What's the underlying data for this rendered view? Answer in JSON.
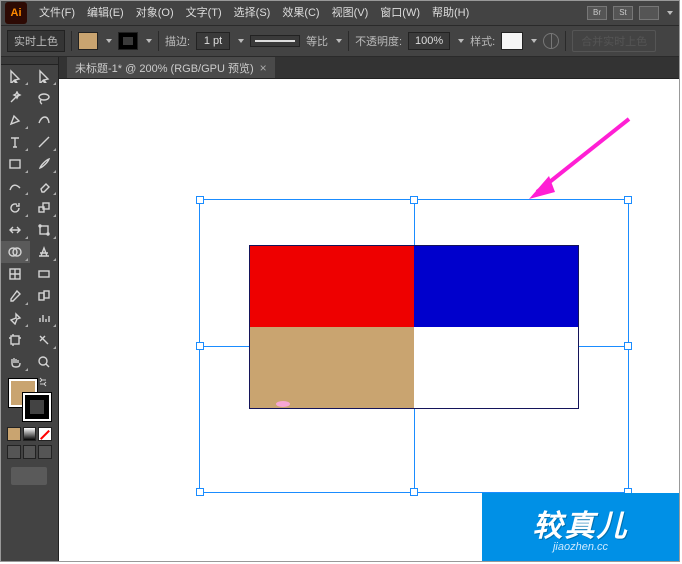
{
  "app_logo": "Ai",
  "menu": {
    "file": "文件(F)",
    "edit": "编辑(E)",
    "object": "对象(O)",
    "type": "文字(T)",
    "select": "选择(S)",
    "effect": "效果(C)",
    "view": "视图(V)",
    "window": "窗口(W)",
    "help": "帮助(H)",
    "br_badge": "Br",
    "st_badge": "St"
  },
  "control": {
    "mode_label": "实时上色",
    "fill_color": "#c9a470",
    "stroke_color": "#000000",
    "stroke_label": "描边:",
    "stroke_weight": "1 pt",
    "stroke_profile_label": "等比",
    "opacity_label": "不透明度:",
    "opacity_value": "100%",
    "style_label": "样式:",
    "merge_button": "合并实时上色"
  },
  "document": {
    "tab_title": "未标题-1* @ 200% (RGB/GPU 预览)",
    "close": "×"
  },
  "artwork": {
    "colors": {
      "red": "#ee0000",
      "blue": "#0000cc",
      "tan": "#c9a470",
      "white": "#ffffff"
    }
  },
  "tools": {
    "selection": "selection-tool",
    "direct": "direct-selection-tool",
    "wand": "magic-wand-tool",
    "lasso": "lasso-tool",
    "pen": "pen-tool",
    "curv": "curvature-tool",
    "type": "type-tool",
    "line": "line-segment-tool",
    "rect": "rectangle-tool",
    "brush": "paintbrush-tool",
    "shaper": "shaper-tool",
    "eraser": "eraser-tool",
    "rotate": "rotate-tool",
    "scale": "scale-tool",
    "width": "width-tool",
    "free": "free-transform-tool",
    "shapeB": "shape-builder-tool",
    "persp": "perspective-grid-tool",
    "mesh": "mesh-tool",
    "grad": "gradient-tool",
    "eyedrop": "eyedropper-tool",
    "blend": "blend-tool",
    "symbol": "symbol-sprayer-tool",
    "graph": "column-graph-tool",
    "artb": "artboard-tool",
    "slice": "slice-tool",
    "hand": "hand-tool",
    "zoom": "zoom-tool"
  },
  "watermark": {
    "title": "较真儿",
    "sub": "jiaozhen.cc"
  }
}
